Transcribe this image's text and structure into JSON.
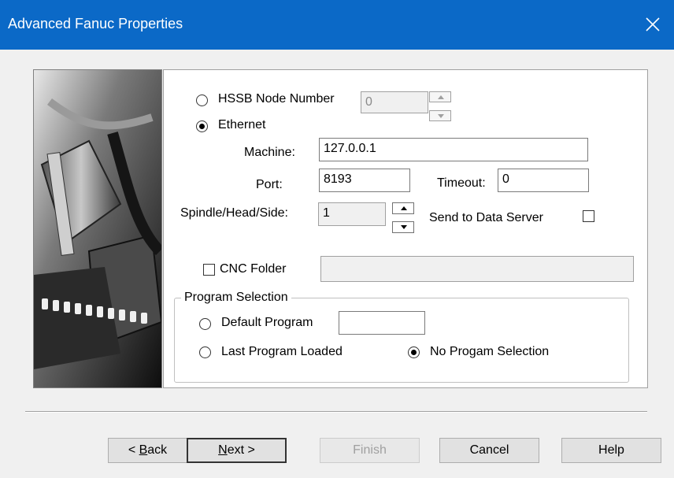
{
  "window": {
    "title": "Advanced Fanuc Properties",
    "close_symbol": "close-icon"
  },
  "connection": {
    "hssb_label": "HSSB Node Number",
    "hssb_value": "0",
    "ethernet_label": "Ethernet",
    "selected": "Ethernet"
  },
  "network": {
    "machine_label": "Machine:",
    "machine_value": "127.0.0.1",
    "port_label": "Port:",
    "port_value": "8193",
    "timeout_label": "Timeout:",
    "timeout_value": "0"
  },
  "spindle": {
    "label": "Spindle/Head/Side:",
    "value": "1",
    "send_label": "Send to Data Server",
    "send_checked": false
  },
  "cnc": {
    "label": "CNC Folder",
    "checked": false,
    "value": ""
  },
  "program": {
    "group_label": "Program Selection",
    "default_label": "Default Program",
    "default_value": "",
    "last_label": "Last Program Loaded",
    "none_label": "No Progam Selection",
    "selected": "No Progam Selection"
  },
  "buttons": {
    "back_prefix": "< ",
    "back_mnemonic": "B",
    "back_rest": "ack",
    "next_mnemonic": "N",
    "next_rest": "ext >",
    "finish": "Finish",
    "cancel": "Cancel",
    "help": "Help"
  },
  "colors": {
    "titlebar": "#0b69c7",
    "window": "#f0f0f0",
    "panel": "#ffffff"
  }
}
